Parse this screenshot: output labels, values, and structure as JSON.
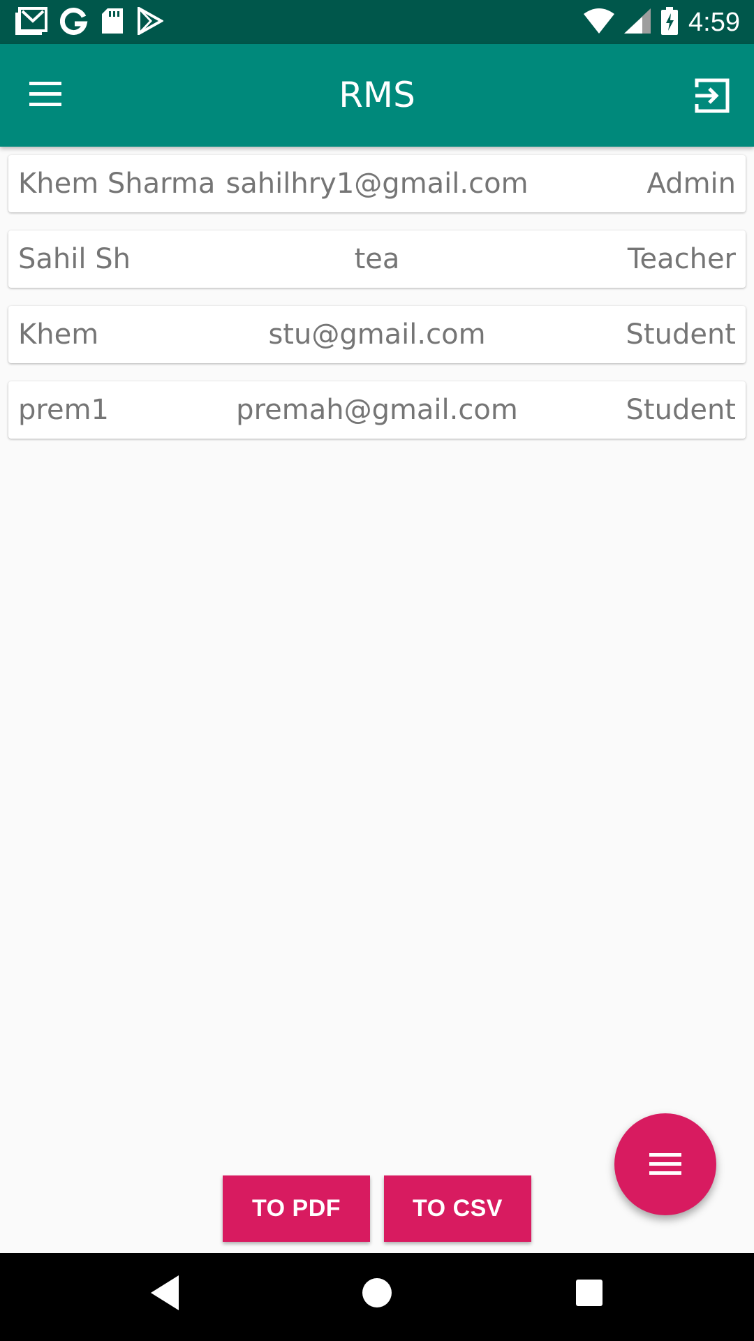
{
  "status_bar": {
    "icons": [
      "gmail-icon",
      "google-icon",
      "sd-card-icon",
      "play-store-icon",
      "wifi-icon",
      "signal-icon",
      "battery-charging-icon"
    ],
    "time": "4:59"
  },
  "app_bar": {
    "title": "RMS",
    "menu_icon": "menu-icon",
    "logout_icon": "logout-icon",
    "color": "#00897b",
    "status_color": "#00574b"
  },
  "users": [
    {
      "name": "Khem Sharma",
      "email": "sahilhry1@gmail.com",
      "role": "Admin"
    },
    {
      "name": "Sahil Sh",
      "email": "tea",
      "role": "Teacher"
    },
    {
      "name": "Khem",
      "email": "stu@gmail.com",
      "role": "Student"
    },
    {
      "name": "prem1",
      "email": "premah@gmail.com",
      "role": "Student"
    }
  ],
  "actions": {
    "pdf_label": "TO PDF",
    "csv_label": "TO CSV",
    "fab_icon": "menu-icon",
    "accent": "#d81b60"
  },
  "nav": {
    "icons": [
      "back-icon",
      "home-icon",
      "recents-icon"
    ]
  }
}
